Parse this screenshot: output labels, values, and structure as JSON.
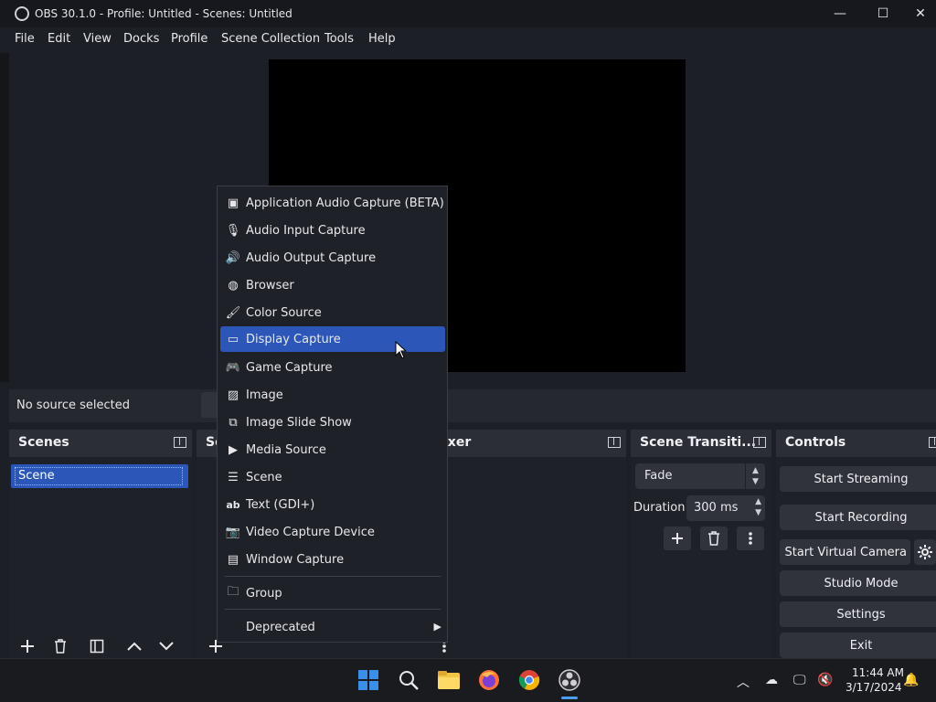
{
  "window": {
    "title": "OBS 30.1.0 - Profile: Untitled - Scenes: Untitled",
    "minimize": "—",
    "maximize": "☐",
    "close": "✕"
  },
  "menubar": [
    "File",
    "Edit",
    "View",
    "Docks",
    "Profile",
    "Scene Collection",
    "Tools",
    "Help"
  ],
  "source_bar": {
    "status": "No source selected"
  },
  "docks": {
    "scenes": {
      "title": "Scenes",
      "items": [
        "Scene"
      ]
    },
    "sources": {
      "title": "So"
    },
    "mixer": {
      "title": "ixer"
    },
    "transitions": {
      "title": "Scene Transiti...",
      "selected": "Fade",
      "duration_label": "Duration",
      "duration_value": "300 ms"
    },
    "controls": {
      "title": "Controls",
      "buttons": [
        "Start Streaming",
        "Start Recording",
        "Start Virtual Camera",
        "Studio Mode",
        "Settings",
        "Exit"
      ]
    }
  },
  "context_menu": {
    "items": [
      {
        "icon": "speaker-app-icon",
        "label": "Application Audio Capture (BETA)"
      },
      {
        "icon": "microphone-icon",
        "label": "Audio Input Capture"
      },
      {
        "icon": "speaker-icon",
        "label": "Audio Output Capture"
      },
      {
        "icon": "globe-icon",
        "label": "Browser"
      },
      {
        "icon": "brush-icon",
        "label": "Color Source"
      },
      {
        "icon": "monitor-icon",
        "label": "Display Capture"
      },
      {
        "icon": "gamepad-icon",
        "label": "Game Capture"
      },
      {
        "icon": "image-icon",
        "label": "Image"
      },
      {
        "icon": "slideshow-icon",
        "label": "Image Slide Show"
      },
      {
        "icon": "play-icon",
        "label": "Media Source"
      },
      {
        "icon": "list-icon",
        "label": "Scene"
      },
      {
        "icon": "text-icon",
        "label": "Text (GDI+)"
      },
      {
        "icon": "camera-icon",
        "label": "Video Capture Device"
      },
      {
        "icon": "window-icon",
        "label": "Window Capture"
      }
    ],
    "group": {
      "icon": "folder-icon",
      "label": "Group"
    },
    "deprecated": {
      "label": "Deprecated"
    },
    "highlighted_index": 5
  },
  "taskbar": {
    "time": "11:44 AM",
    "date": "3/17/2024"
  },
  "colors": {
    "accent": "#2c56b8",
    "background": "#1d1f26",
    "panel": "#1f2128",
    "header": "#2b2e37"
  }
}
